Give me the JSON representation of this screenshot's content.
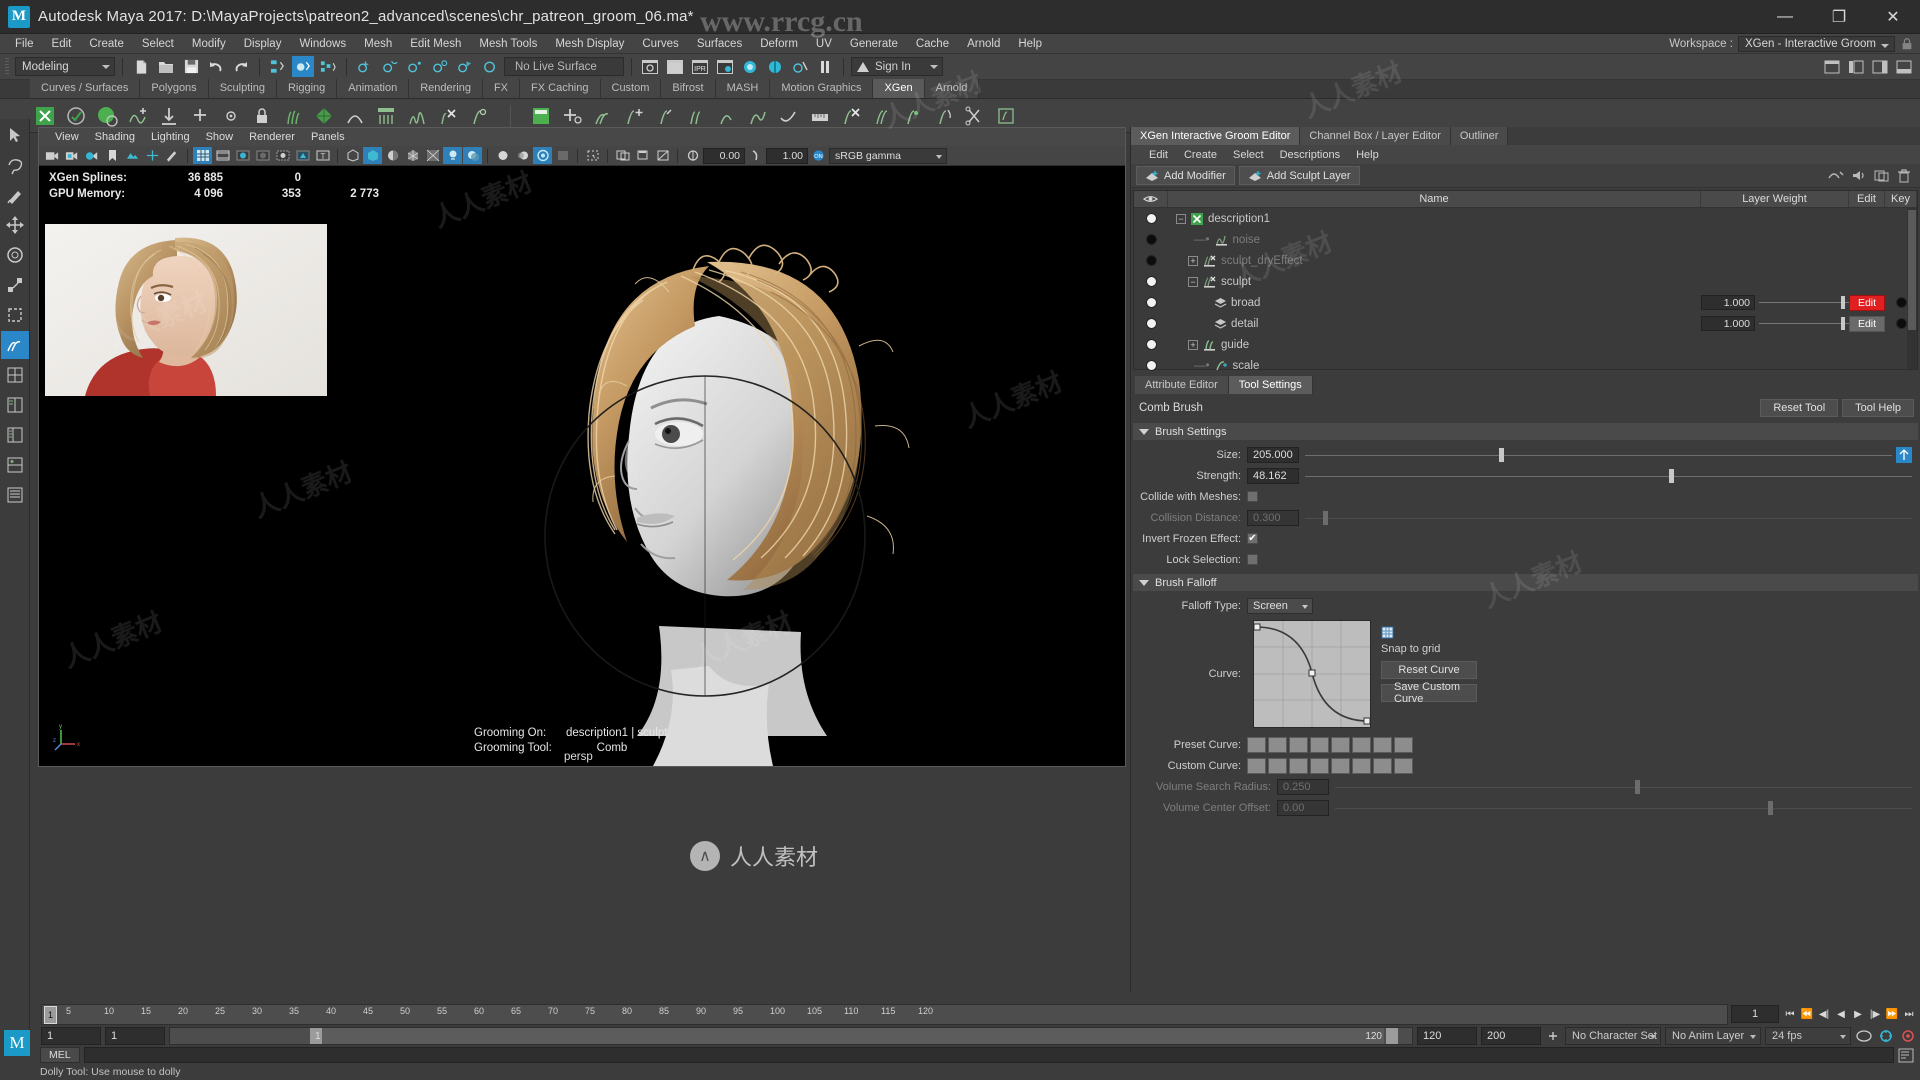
{
  "titlebar": {
    "logo": "M",
    "title": "Autodesk Maya 2017: D:\\MayaProjects\\patreon2_advanced\\scenes\\chr_patreon_groom_06.ma*",
    "minimize": "—",
    "maximize": "❐",
    "close": "✕"
  },
  "menubar": {
    "items": [
      "File",
      "Edit",
      "Create",
      "Select",
      "Modify",
      "Display",
      "Windows",
      "Mesh",
      "Edit Mesh",
      "Mesh Tools",
      "Mesh Display",
      "Curves",
      "Surfaces",
      "Deform",
      "UV",
      "Generate",
      "Cache",
      "Arnold",
      "Help"
    ],
    "workspace_label": "Workspace :",
    "workspace_value": "XGen - Interactive Groom"
  },
  "statusline": {
    "mode": "Modeling",
    "live_surface": "No Live Surface",
    "signin": "Sign In",
    "ipr_label": "IPR"
  },
  "shelf": {
    "tabs": [
      "Curves / Surfaces",
      "Polygons",
      "Sculpting",
      "Rigging",
      "Animation",
      "Rendering",
      "FX",
      "FX Caching",
      "Custom",
      "Bifrost",
      "MASH",
      "Motion Graphics",
      "XGen",
      "Arnold"
    ],
    "active_tab": "XGen"
  },
  "viewport": {
    "menu": [
      "View",
      "Shading",
      "Lighting",
      "Show",
      "Renderer",
      "Panels"
    ],
    "exposure": "0.00",
    "gamma_value": "1.00",
    "color_space": "sRGB gamma",
    "hud": {
      "rows": [
        {
          "label": "XGen Splines:",
          "v1": "36 885",
          "v2": "0",
          "v3": ""
        },
        {
          "label": "GPU Memory:",
          "v1": "4 096",
          "v2": "353",
          "v3": "2 773"
        }
      ]
    },
    "footer": {
      "grooming_on_label": "Grooming On:",
      "grooming_on_value": "description1 | sculpt",
      "grooming_tool_label": "Grooming Tool:",
      "grooming_tool_value": "Comb",
      "camera": "persp"
    },
    "axis": {
      "x": "x",
      "y": "y",
      "z": "z"
    }
  },
  "right_panel": {
    "tabs": [
      {
        "label": "XGen Interactive Groom Editor",
        "active": true
      },
      {
        "label": "Channel Box / Layer Editor",
        "active": false
      },
      {
        "label": "Outliner",
        "active": false
      }
    ],
    "menu": [
      "Edit",
      "Create",
      "Select",
      "Descriptions",
      "Help"
    ],
    "toolbar": {
      "add_modifier": "Add Modifier",
      "add_sculpt_layer": "Add Sculpt Layer"
    },
    "layer_table": {
      "headers": {
        "eye": "eye-icon",
        "name": "Name",
        "weight": "Layer Weight",
        "edit": "Edit",
        "key": "Key"
      },
      "rows": [
        {
          "name": "description1",
          "indent": 0,
          "visible": true,
          "expander": "−",
          "icon": "description-icon",
          "dim": false,
          "weight": null,
          "edit": null,
          "edit_style": "none",
          "key": false
        },
        {
          "name": "noise",
          "indent": 1,
          "visible": false,
          "expander": "",
          "icon": "noise-modifier-icon",
          "dim": true,
          "weight": null,
          "edit": null,
          "edit_style": "none",
          "key": false
        },
        {
          "name": "sculpt_dryEffect",
          "indent": 1,
          "visible": false,
          "expander": "+",
          "icon": "sculpt-modifier-icon",
          "dim": true,
          "weight": null,
          "edit": null,
          "edit_style": "none",
          "key": false
        },
        {
          "name": "sculpt",
          "indent": 1,
          "visible": true,
          "expander": "−",
          "icon": "sculpt-modifier-icon",
          "dim": false,
          "weight": null,
          "edit": null,
          "edit_style": "none",
          "key": false
        },
        {
          "name": "broad",
          "indent": 2,
          "visible": true,
          "expander": "",
          "icon": "layer-icon",
          "dim": false,
          "weight": "1.000",
          "edit": "Edit",
          "edit_style": "red",
          "key": true
        },
        {
          "name": "detail",
          "indent": 2,
          "visible": true,
          "expander": "",
          "icon": "layer-icon",
          "dim": false,
          "weight": "1.000",
          "edit": "Edit",
          "edit_style": "normal",
          "key": true
        },
        {
          "name": "guide",
          "indent": 1,
          "visible": true,
          "expander": "+",
          "icon": "guide-modifier-icon",
          "dim": false,
          "weight": null,
          "edit": null,
          "edit_style": "none",
          "key": false
        },
        {
          "name": "scale",
          "indent": 1,
          "visible": true,
          "expander": "",
          "icon": "scale-modifier-icon",
          "dim": false,
          "weight": null,
          "edit": null,
          "edit_style": "none",
          "key": false
        }
      ]
    },
    "tool_settings": {
      "tabs": [
        {
          "label": "Attribute Editor",
          "active": false
        },
        {
          "label": "Tool Settings",
          "active": true
        }
      ],
      "tool_name": "Comb Brush",
      "reset_tool": "Reset Tool",
      "tool_help": "Tool Help",
      "brush_settings_title": "Brush Settings",
      "brush_falloff_title": "Brush Falloff",
      "fields": {
        "size_label": "Size:",
        "size_value": "205.000",
        "strength_label": "Strength:",
        "strength_value": "48.162",
        "collide_label": "Collide with Meshes:",
        "collision_distance_label": "Collision Distance:",
        "collision_distance_value": "0.300",
        "invert_frozen_label": "Invert Frozen Effect:",
        "lock_selection_label": "Lock Selection:",
        "falloff_type_label": "Falloff Type:",
        "falloff_type_value": "Screen",
        "curve_label": "Curve:",
        "snap_to_grid": "Snap to grid",
        "reset_curve": "Reset Curve",
        "save_custom_curve": "Save Custom Curve",
        "preset_curve_label": "Preset Curve:",
        "custom_curve_label": "Custom Curve:",
        "volume_search_radius_label": "Volume Search Radius:",
        "volume_search_radius_value": "0.250",
        "volume_center_offset_label": "Volume Center Offset:",
        "volume_center_offset_value": "0.00"
      },
      "checks": {
        "collide_with_meshes": false,
        "invert_frozen_effect": true,
        "lock_selection": false
      },
      "preset_swatch_count": 8,
      "custom_swatch_count": 8
    }
  },
  "timeline": {
    "ticks": [
      "1",
      "5",
      "10",
      "15",
      "20",
      "25",
      "30",
      "35",
      "40",
      "45",
      "50",
      "55",
      "60",
      "65",
      "70",
      "75",
      "80",
      "85",
      "90",
      "95",
      "100",
      "105",
      "110",
      "115",
      "120"
    ],
    "current_frame": "1",
    "frame_field": "1",
    "playback": [
      "⏮",
      "⏪",
      "◀|",
      "◀",
      "▶",
      "|▶",
      "⏩",
      "⏭"
    ]
  },
  "rangebar": {
    "start": "1",
    "start2": "1",
    "bar_start": "1",
    "bar_end": "120",
    "end_field": "120",
    "max_field": "200",
    "character_set": "No Character Set",
    "anim_layer": "No Anim Layer",
    "fps": "24 fps"
  },
  "commandline": {
    "mel_label": "MEL",
    "input_value": ""
  },
  "statusbar": {
    "message": "Dolly Tool: Use mouse to dolly"
  },
  "watermarks": {
    "site": "www.rrcg.cn",
    "cn_text": "人人素材",
    "logo_char": "∧"
  },
  "colors": {
    "accent_blue": "#2b88c8",
    "panel_bg": "#3c3c3c",
    "toolbar_bg": "#444444",
    "red_edit": "#e02020",
    "xgen_green": "#4caf50"
  }
}
